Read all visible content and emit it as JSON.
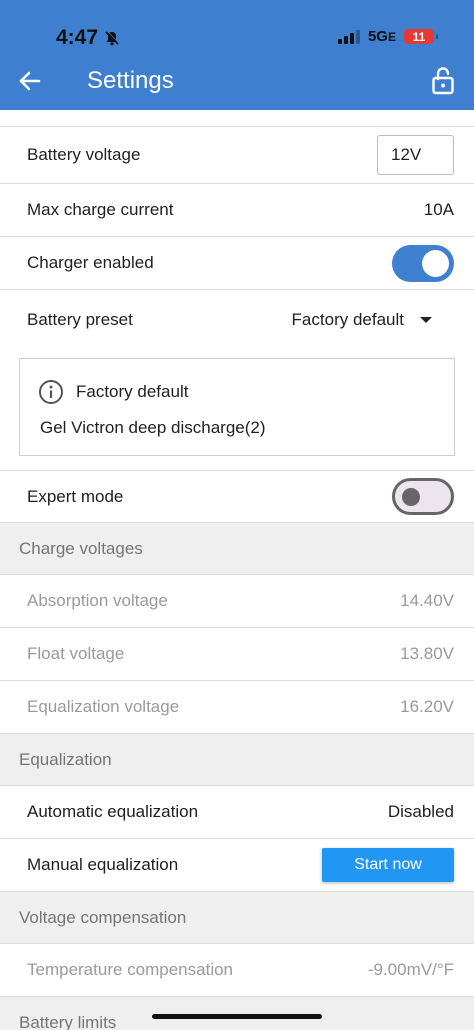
{
  "status_bar": {
    "time": "4:47",
    "network": "5G",
    "network_suffix": "E",
    "battery": "11"
  },
  "header": {
    "title": "Settings"
  },
  "settings": {
    "battery_voltage": {
      "label": "Battery voltage",
      "value": "12V"
    },
    "max_charge_current": {
      "label": "Max charge current",
      "value": "10A"
    },
    "charger_enabled": {
      "label": "Charger enabled",
      "state": "on"
    },
    "battery_preset": {
      "label": "Battery preset",
      "value": "Factory default"
    },
    "preset_info": {
      "title": "Factory default",
      "description": "Gel Victron deep discharge(2)"
    },
    "expert_mode": {
      "label": "Expert mode",
      "state": "off"
    }
  },
  "charge_voltages": {
    "header": "Charge voltages",
    "rows": [
      {
        "label": "Absorption voltage",
        "value": "14.40V"
      },
      {
        "label": "Float voltage",
        "value": "13.80V"
      },
      {
        "label": "Equalization voltage",
        "value": "16.20V"
      }
    ]
  },
  "equalization": {
    "header": "Equalization",
    "automatic": {
      "label": "Automatic equalization",
      "value": "Disabled"
    },
    "manual": {
      "label": "Manual equalization",
      "button": "Start now"
    }
  },
  "voltage_compensation": {
    "header": "Voltage compensation",
    "temperature": {
      "label": "Temperature compensation",
      "value": "-9.00mV/°F"
    }
  },
  "battery_limits": {
    "header": "Battery limits"
  },
  "colors": {
    "primary": "#3f7fcf",
    "button": "#2196f3",
    "battery_low": "#e53935"
  }
}
